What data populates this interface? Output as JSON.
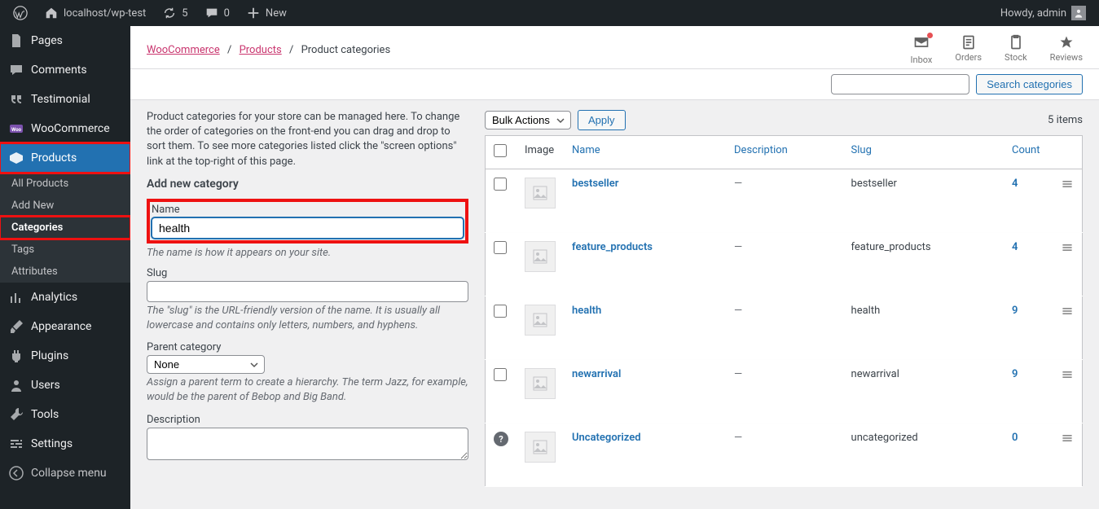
{
  "adminbar": {
    "site_name": "localhost/wp-test",
    "updates_count": "5",
    "comments_count": "0",
    "new_label": "New",
    "howdy": "Howdy, admin"
  },
  "sidebar": {
    "items": [
      {
        "label": "Pages"
      },
      {
        "label": "Comments"
      },
      {
        "label": "Testimonial"
      },
      {
        "label": "WooCommerce"
      },
      {
        "label": "Products"
      },
      {
        "label": "Analytics"
      },
      {
        "label": "Appearance"
      },
      {
        "label": "Plugins"
      },
      {
        "label": "Users"
      },
      {
        "label": "Tools"
      },
      {
        "label": "Settings"
      }
    ],
    "products_sub": [
      {
        "label": "All Products"
      },
      {
        "label": "Add New"
      },
      {
        "label": "Categories"
      },
      {
        "label": "Tags"
      },
      {
        "label": "Attributes"
      }
    ],
    "collapse": "Collapse menu"
  },
  "breadcrumb": {
    "woocommerce": "WooCommerce",
    "products": "Products",
    "current": "Product categories"
  },
  "topicons": {
    "inbox": "Inbox",
    "orders": "Orders",
    "stock": "Stock",
    "reviews": "Reviews"
  },
  "search": {
    "button": "Search categories"
  },
  "intro": "Product categories for your store can be managed here. To change the order of categories on the front-end you can drag and drop to sort them. To see more categories listed click the \"screen options\" link at the top-right of this page.",
  "form": {
    "heading": "Add new category",
    "name_label": "Name",
    "name_value": "health",
    "name_hint": "The name is how it appears on your site.",
    "slug_label": "Slug",
    "slug_value": "",
    "slug_hint": "The \"slug\" is the URL-friendly version of the name. It is usually all lowercase and contains only letters, numbers, and hyphens.",
    "parent_label": "Parent category",
    "parent_value": "None",
    "parent_hint": "Assign a parent term to create a hierarchy. The term Jazz, for example, would be the parent of Bebop and Big Band.",
    "desc_label": "Description"
  },
  "table": {
    "bulk": "Bulk Actions",
    "apply": "Apply",
    "items_count": "5 items",
    "columns": {
      "image": "Image",
      "name": "Name",
      "description": "Description",
      "slug": "Slug",
      "count": "Count"
    },
    "rows": [
      {
        "name": "bestseller",
        "desc": "—",
        "slug": "bestseller",
        "count": "4"
      },
      {
        "name": "feature_products",
        "desc": "—",
        "slug": "feature_products",
        "count": "4"
      },
      {
        "name": "health",
        "desc": "—",
        "slug": "health",
        "count": "9"
      },
      {
        "name": "newarrival",
        "desc": "—",
        "slug": "newarrival",
        "count": "9"
      },
      {
        "name": "Uncategorized",
        "desc": "—",
        "slug": "uncategorized",
        "count": "0"
      }
    ]
  }
}
